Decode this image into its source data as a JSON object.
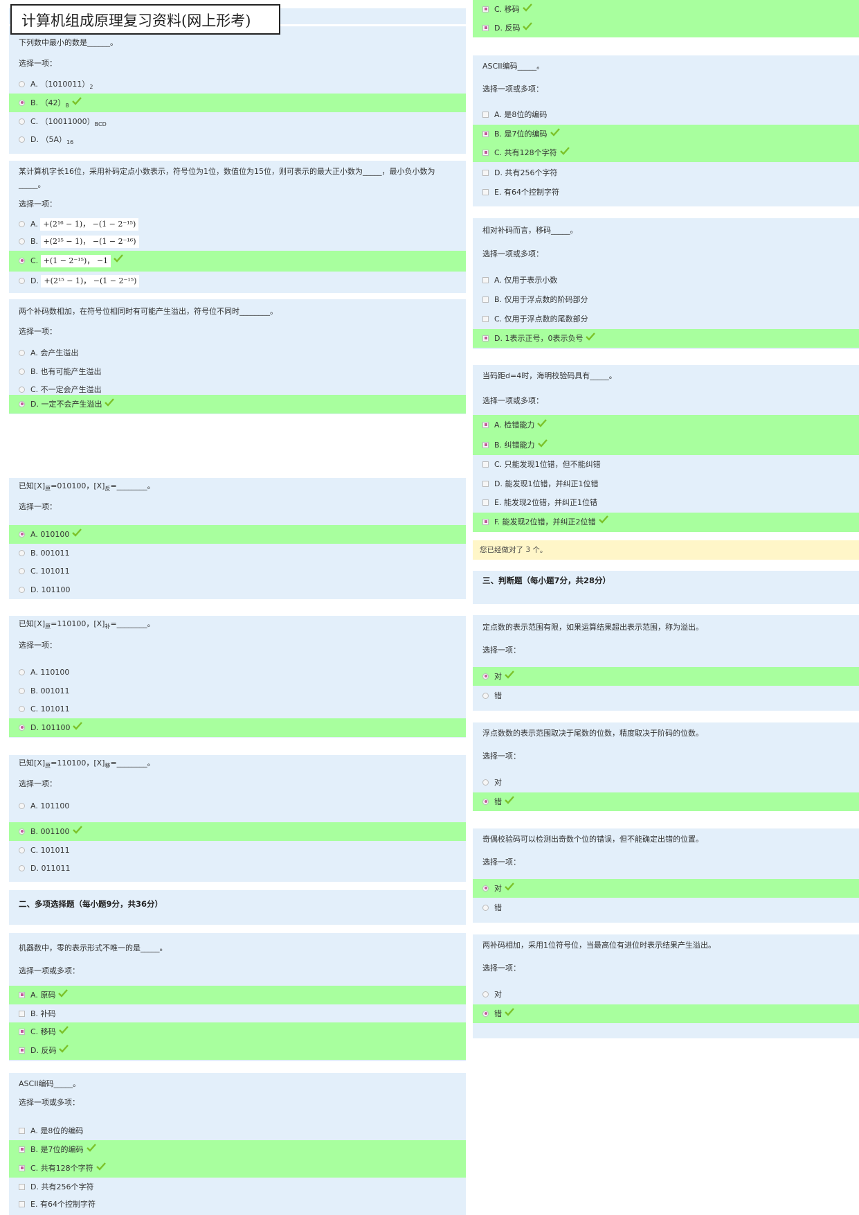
{
  "title": "计算机组成原理复习资料(网上形考)",
  "prompts": {
    "single": "选择一项：",
    "multi": "选择一项或多项："
  },
  "left": {
    "q1": {
      "text": "下列数中最小的数是______。",
      "options": [
        {
          "label": "A. （1010011）",
          "sub": "2"
        },
        {
          "label": "B. （42）",
          "sub": "8"
        },
        {
          "label": "C. （10011000）",
          "sub": "BCD"
        },
        {
          "label": "D. （5A）",
          "sub": "16"
        }
      ]
    },
    "q2": {
      "text": "某计算机字长16位，采用补码定点小数表示，符号位为1位，数值位为15位，则可表示的最大正小数为_____，最小负小数为_____。",
      "options": [
        {
          "label": "A.",
          "formula": "+(2¹⁶ − 1)，  −(1 − 2⁻¹⁵)"
        },
        {
          "label": "B.",
          "formula": "+(2¹⁵ − 1)，  −(1 − 2⁻¹⁶)"
        },
        {
          "label": "C.",
          "formula": "+(1 − 2⁻¹⁵)，  −1"
        },
        {
          "label": "D.",
          "formula": "+(2¹⁵ − 1)，  −(1 − 2⁻¹⁵)"
        }
      ]
    },
    "q3": {
      "text": "两个补码数相加，在符号位相同时有可能产生溢出，符号位不同时________。",
      "options": [
        "A. 会产生溢出",
        "B. 也有可能产生溢出",
        "C. 不一定会产生溢出",
        "D. 一定不会产生溢出"
      ]
    },
    "q4": {
      "pre": "已知[X]",
      "sub1": "原",
      "mid": "=010100，[X]",
      "sub2": "反",
      "post": "=________。",
      "options": [
        "A. 010100",
        "B. 001011",
        "C. 101011",
        "D. 101100"
      ]
    },
    "q5": {
      "pre": "已知[X]",
      "sub1": "原",
      "mid": "=110100，[X]",
      "sub2": "补",
      "post": "=________。",
      "options": [
        "A. 110100",
        "B. 001011",
        "C. 101011",
        "D. 101100"
      ]
    },
    "q6": {
      "pre": "已知[X]",
      "sub1": "原",
      "mid": "=110100，[X]",
      "sub2": "移",
      "post": "=________。",
      "options": [
        "A. 101100",
        "B. 001100",
        "C. 101011",
        "D. 011011"
      ]
    },
    "section2": "二、多项选择题（每小题9分，共36分）",
    "q7": {
      "text": "机器数中，零的表示形式不唯一的是_____。",
      "options": [
        "A. 原码",
        "B. 补码",
        "C. 移码",
        "D. 反码"
      ]
    },
    "q8": {
      "text": "ASCII编码_____。",
      "options": [
        "A. 是8位的编码",
        "B. 是7位的编码",
        "C. 共有128个字符",
        "D. 共有256个字符",
        "E. 有64个控制字符"
      ]
    }
  },
  "right": {
    "q0": {
      "options": [
        "C. 移码",
        "D. 反码"
      ]
    },
    "q1": {
      "text": "ASCII编码_____。",
      "options": [
        "A. 是8位的编码",
        "B. 是7位的编码",
        "C. 共有128个字符",
        "D. 共有256个字符",
        "E. 有64个控制字符"
      ]
    },
    "q2": {
      "text": "相对补码而言，移码_____。",
      "options": [
        "A. 仅用于表示小数",
        "B. 仅用于浮点数的阶码部分",
        "C. 仅用于浮点数的尾数部分",
        "D. 1表示正号，0表示负号"
      ]
    },
    "q3": {
      "text": "当码距d=4时，海明校验码具有_____。",
      "options": [
        "A. 检错能力",
        "B. 纠错能力",
        "C. 只能发现1位错，但不能纠错",
        "D. 能发现1位错，并纠正1位错",
        "E. 能发现2位错，并纠正1位错",
        "F. 能发现2位错，并纠正2位错"
      ]
    },
    "notice": "您已经做对了 3 个。",
    "section3": "三、判断题（每小题7分，共28分）",
    "q4": {
      "text": "定点数的表示范围有限，如果运算结果超出表示范围，称为溢出。",
      "options": [
        "对",
        "错"
      ]
    },
    "q5": {
      "text": "浮点数数的表示范围取决于尾数的位数，精度取决于阶码的位数。",
      "options": [
        "对",
        "错"
      ]
    },
    "q6": {
      "text": "奇偶校验码可以检测出奇数个位的错误，但不能确定出错的位置。",
      "options": [
        "对",
        "错"
      ]
    },
    "q7": {
      "text": "两补码相加，采用1位符号位，当最高位有进位时表示结果产生溢出。",
      "options": [
        "对",
        "错"
      ]
    }
  }
}
